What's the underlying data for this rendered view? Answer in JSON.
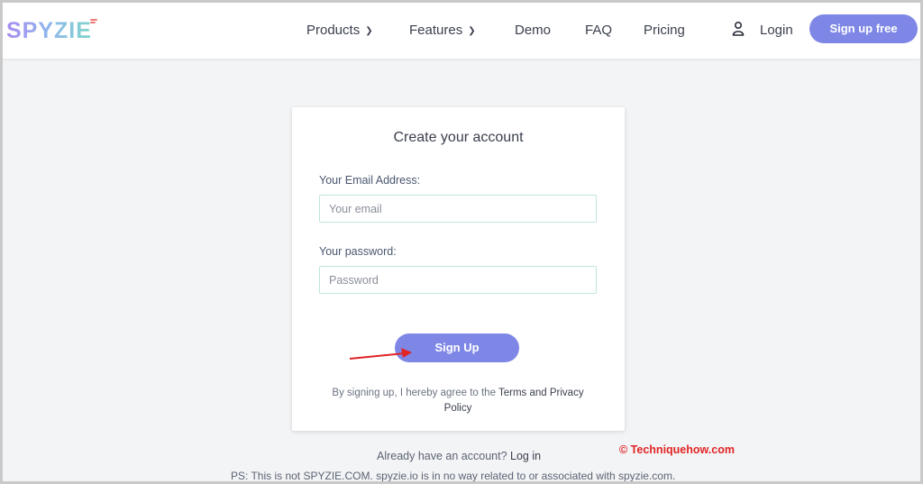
{
  "brand": {
    "logo_text": "SPYZIE"
  },
  "nav": {
    "products": "Products",
    "features": "Features",
    "demo": "Demo",
    "faq": "FAQ",
    "pricing": "Pricing",
    "login": "Login",
    "signup_free": "Sign up free"
  },
  "form": {
    "title": "Create your account",
    "email_label": "Your Email Address:",
    "email_placeholder": "Your email",
    "email_value": "",
    "password_label": "Your password:",
    "password_placeholder": "Password",
    "password_value": "",
    "submit_label": "Sign Up",
    "terms_prefix": "By signing up, I hereby agree to the",
    "terms_link": "Terms and Privacy",
    "terms_link2": "Policy"
  },
  "footer": {
    "already_text": "Already have an account?",
    "login_link": "Log in",
    "disclaimer": "PS: This is not SPYZIE.COM. spyzie.io is in no way related to or associated with spyzie.com."
  },
  "watermark": "© Techniquehow.com",
  "colors": {
    "accent": "#7e87e6",
    "input_border": "#bfe4df",
    "annotation_arrow": "#e02424"
  },
  "icons": {
    "chevron": "chevron-down-icon",
    "user": "user-icon",
    "arrow": "arrow-right-annotation"
  }
}
